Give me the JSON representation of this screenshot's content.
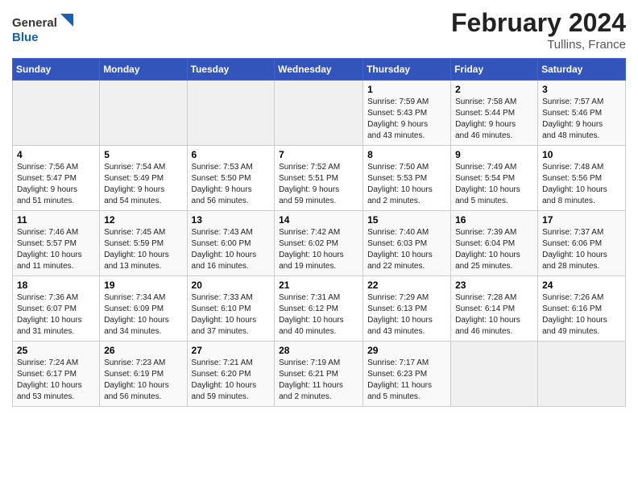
{
  "header": {
    "logo_general": "General",
    "logo_blue": "Blue",
    "month_title": "February 2024",
    "location": "Tullins, France"
  },
  "columns": [
    "Sunday",
    "Monday",
    "Tuesday",
    "Wednesday",
    "Thursday",
    "Friday",
    "Saturday"
  ],
  "weeks": [
    [
      {
        "day": "",
        "info": ""
      },
      {
        "day": "",
        "info": ""
      },
      {
        "day": "",
        "info": ""
      },
      {
        "day": "",
        "info": ""
      },
      {
        "day": "1",
        "info": "Sunrise: 7:59 AM\nSunset: 5:43 PM\nDaylight: 9 hours\nand 43 minutes."
      },
      {
        "day": "2",
        "info": "Sunrise: 7:58 AM\nSunset: 5:44 PM\nDaylight: 9 hours\nand 46 minutes."
      },
      {
        "day": "3",
        "info": "Sunrise: 7:57 AM\nSunset: 5:46 PM\nDaylight: 9 hours\nand 48 minutes."
      }
    ],
    [
      {
        "day": "4",
        "info": "Sunrise: 7:56 AM\nSunset: 5:47 PM\nDaylight: 9 hours\nand 51 minutes."
      },
      {
        "day": "5",
        "info": "Sunrise: 7:54 AM\nSunset: 5:49 PM\nDaylight: 9 hours\nand 54 minutes."
      },
      {
        "day": "6",
        "info": "Sunrise: 7:53 AM\nSunset: 5:50 PM\nDaylight: 9 hours\nand 56 minutes."
      },
      {
        "day": "7",
        "info": "Sunrise: 7:52 AM\nSunset: 5:51 PM\nDaylight: 9 hours\nand 59 minutes."
      },
      {
        "day": "8",
        "info": "Sunrise: 7:50 AM\nSunset: 5:53 PM\nDaylight: 10 hours\nand 2 minutes."
      },
      {
        "day": "9",
        "info": "Sunrise: 7:49 AM\nSunset: 5:54 PM\nDaylight: 10 hours\nand 5 minutes."
      },
      {
        "day": "10",
        "info": "Sunrise: 7:48 AM\nSunset: 5:56 PM\nDaylight: 10 hours\nand 8 minutes."
      }
    ],
    [
      {
        "day": "11",
        "info": "Sunrise: 7:46 AM\nSunset: 5:57 PM\nDaylight: 10 hours\nand 11 minutes."
      },
      {
        "day": "12",
        "info": "Sunrise: 7:45 AM\nSunset: 5:59 PM\nDaylight: 10 hours\nand 13 minutes."
      },
      {
        "day": "13",
        "info": "Sunrise: 7:43 AM\nSunset: 6:00 PM\nDaylight: 10 hours\nand 16 minutes."
      },
      {
        "day": "14",
        "info": "Sunrise: 7:42 AM\nSunset: 6:02 PM\nDaylight: 10 hours\nand 19 minutes."
      },
      {
        "day": "15",
        "info": "Sunrise: 7:40 AM\nSunset: 6:03 PM\nDaylight: 10 hours\nand 22 minutes."
      },
      {
        "day": "16",
        "info": "Sunrise: 7:39 AM\nSunset: 6:04 PM\nDaylight: 10 hours\nand 25 minutes."
      },
      {
        "day": "17",
        "info": "Sunrise: 7:37 AM\nSunset: 6:06 PM\nDaylight: 10 hours\nand 28 minutes."
      }
    ],
    [
      {
        "day": "18",
        "info": "Sunrise: 7:36 AM\nSunset: 6:07 PM\nDaylight: 10 hours\nand 31 minutes."
      },
      {
        "day": "19",
        "info": "Sunrise: 7:34 AM\nSunset: 6:09 PM\nDaylight: 10 hours\nand 34 minutes."
      },
      {
        "day": "20",
        "info": "Sunrise: 7:33 AM\nSunset: 6:10 PM\nDaylight: 10 hours\nand 37 minutes."
      },
      {
        "day": "21",
        "info": "Sunrise: 7:31 AM\nSunset: 6:12 PM\nDaylight: 10 hours\nand 40 minutes."
      },
      {
        "day": "22",
        "info": "Sunrise: 7:29 AM\nSunset: 6:13 PM\nDaylight: 10 hours\nand 43 minutes."
      },
      {
        "day": "23",
        "info": "Sunrise: 7:28 AM\nSunset: 6:14 PM\nDaylight: 10 hours\nand 46 minutes."
      },
      {
        "day": "24",
        "info": "Sunrise: 7:26 AM\nSunset: 6:16 PM\nDaylight: 10 hours\nand 49 minutes."
      }
    ],
    [
      {
        "day": "25",
        "info": "Sunrise: 7:24 AM\nSunset: 6:17 PM\nDaylight: 10 hours\nand 53 minutes."
      },
      {
        "day": "26",
        "info": "Sunrise: 7:23 AM\nSunset: 6:19 PM\nDaylight: 10 hours\nand 56 minutes."
      },
      {
        "day": "27",
        "info": "Sunrise: 7:21 AM\nSunset: 6:20 PM\nDaylight: 10 hours\nand 59 minutes."
      },
      {
        "day": "28",
        "info": "Sunrise: 7:19 AM\nSunset: 6:21 PM\nDaylight: 11 hours\nand 2 minutes."
      },
      {
        "day": "29",
        "info": "Sunrise: 7:17 AM\nSunset: 6:23 PM\nDaylight: 11 hours\nand 5 minutes."
      },
      {
        "day": "",
        "info": ""
      },
      {
        "day": "",
        "info": ""
      }
    ]
  ]
}
